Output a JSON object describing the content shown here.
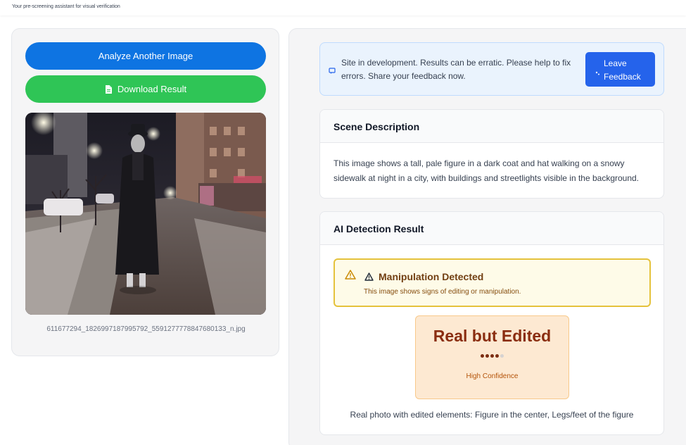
{
  "header": {
    "tagline": "Your pre-screening assistant for visual verification"
  },
  "left": {
    "analyze_label": "Analyze Another Image",
    "download_label": "Download Result",
    "filename": "611677294_1826997187995792_5591277778847680133_n.jpg"
  },
  "notice": {
    "text": "Site in development. Results can be erratic. Please help to fix errors. Share your feedback now.",
    "button_label": "Leave Feedback"
  },
  "scene": {
    "title": "Scene Description",
    "body": "This image shows a tall, pale figure in a dark coat and hat walking on a snowy sidewalk at night in a city, with buildings and streetlights visible in the background."
  },
  "ai": {
    "title": "AI Detection Result",
    "alert_title": "Manipulation Detected",
    "alert_text": "This image shows signs of editing or manipulation.",
    "verdict": "Real but Edited",
    "confidence_dots_filled": 4,
    "confidence_dots_total": 5,
    "confidence_label": "High Confidence",
    "summary": "Real photo with edited elements: Figure in the center, Legs/feet of the figure"
  },
  "colors": {
    "primary_blue": "#0e74e2",
    "success_green": "#2fc556",
    "warning_border": "#e5c23c",
    "verdict_text": "#8a2d10"
  }
}
